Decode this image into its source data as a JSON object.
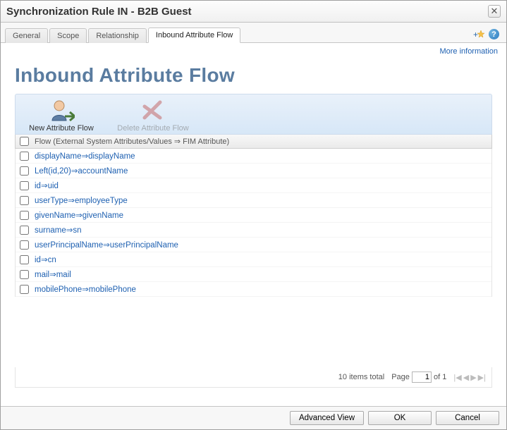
{
  "window": {
    "title": "Synchronization Rule IN - B2B Guest"
  },
  "tabs": [
    {
      "label": "General"
    },
    {
      "label": "Scope"
    },
    {
      "label": "Relationship"
    },
    {
      "label": "Inbound Attribute Flow"
    }
  ],
  "active_tab_index": 3,
  "more_info_label": "More information",
  "heading": "Inbound Attribute Flow",
  "toolbar": {
    "new_label": "New Attribute Flow",
    "delete_label": "Delete Attribute Flow"
  },
  "grid": {
    "header_label": "Flow (External System Attributes/Values ⇒ FIM Attribute)",
    "rows": [
      {
        "label": "displayName⇒displayName"
      },
      {
        "label": "Left(id,20)⇒accountName"
      },
      {
        "label": "id⇒uid"
      },
      {
        "label": "userType⇒employeeType"
      },
      {
        "label": "givenName⇒givenName"
      },
      {
        "label": "surname⇒sn"
      },
      {
        "label": "userPrincipalName⇒userPrincipalName"
      },
      {
        "label": "id⇒cn"
      },
      {
        "label": "mail⇒mail"
      },
      {
        "label": "mobilePhone⇒mobilePhone"
      }
    ]
  },
  "pager": {
    "total_label": "10 items total",
    "page_label": "Page",
    "page_value": "1",
    "of_label": "of 1"
  },
  "footer": {
    "advanced_label": "Advanced View",
    "ok_label": "OK",
    "cancel_label": "Cancel"
  }
}
